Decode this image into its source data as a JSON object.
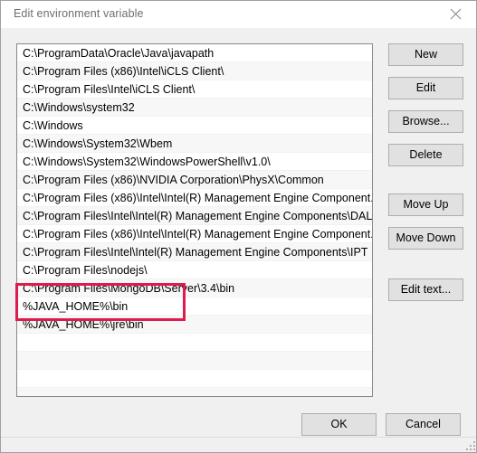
{
  "window": {
    "title": "Edit environment variable",
    "close_icon": "close-icon"
  },
  "list": {
    "items": [
      "C:\\ProgramData\\Oracle\\Java\\javapath",
      "C:\\Program Files (x86)\\Intel\\iCLS Client\\",
      "C:\\Program Files\\Intel\\iCLS Client\\",
      "C:\\Windows\\system32",
      "C:\\Windows",
      "C:\\Windows\\System32\\Wbem",
      "C:\\Windows\\System32\\WindowsPowerShell\\v1.0\\",
      "C:\\Program Files (x86)\\NVIDIA Corporation\\PhysX\\Common",
      "C:\\Program Files (x86)\\Intel\\Intel(R) Management Engine Component...",
      "C:\\Program Files\\Intel\\Intel(R) Management Engine Components\\DAL",
      "C:\\Program Files (x86)\\Intel\\Intel(R) Management Engine Component...",
      "C:\\Program Files\\Intel\\Intel(R) Management Engine Components\\IPT",
      "C:\\Program Files\\nodejs\\",
      "C:\\Program Files\\MongoDB\\Server\\3.4\\bin",
      "%JAVA_HOME%\\bin",
      "%JAVA_HOME%\\jre\\bin"
    ],
    "empty_row_count": 4,
    "highlighted_indices": [
      14,
      15
    ]
  },
  "annotation": {
    "color": "#e01b4c",
    "targets": "%JAVA_HOME%\\bin and %JAVA_HOME%\\jre\\bin"
  },
  "side_buttons": {
    "new": "New",
    "edit": "Edit",
    "browse": "Browse...",
    "delete": "Delete",
    "move_up": "Move Up",
    "move_down": "Move Down",
    "edit_text": "Edit text..."
  },
  "bottom_buttons": {
    "ok": "OK",
    "cancel": "Cancel"
  }
}
